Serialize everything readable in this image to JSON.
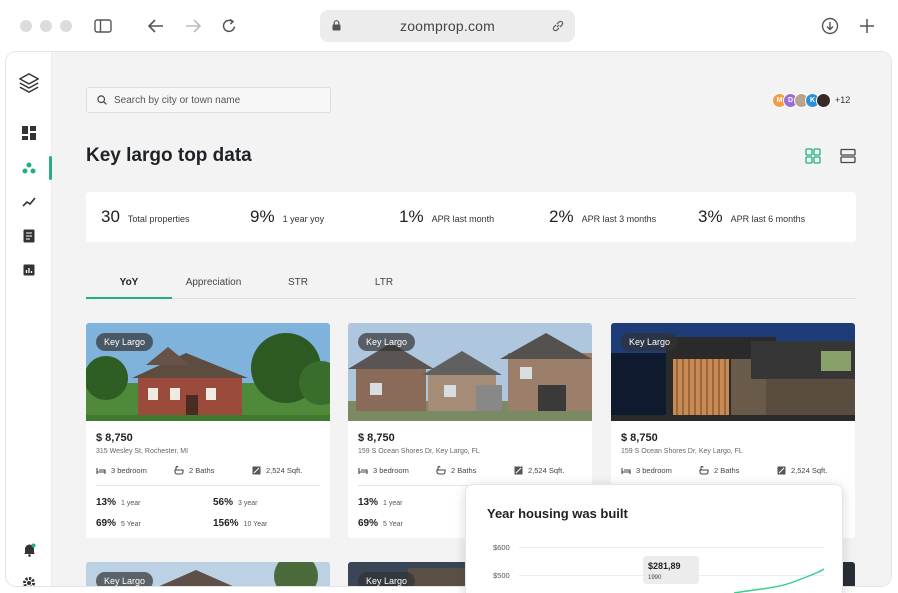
{
  "browser": {
    "url": "zoomprop.com"
  },
  "search": {
    "placeholder": "Search by city or town name"
  },
  "avatars": {
    "initials": [
      "M",
      "D",
      "",
      "K",
      ""
    ],
    "more_label": "+12"
  },
  "page": {
    "title": "Key largo top data"
  },
  "stats": [
    {
      "value": "30",
      "label": "Total properties"
    },
    {
      "value": "9%",
      "label": "1 year yoy"
    },
    {
      "value": "1%",
      "label": "APR last month"
    },
    {
      "value": "2%",
      "label": "APR last 3 months"
    },
    {
      "value": "3%",
      "label": "APR last 6 months"
    }
  ],
  "tabs": [
    "YoY",
    "Appreciation",
    "STR",
    "LTR"
  ],
  "active_tab": "YoY",
  "cards": [
    {
      "badge": "Key Largo",
      "price": "$ 8,750",
      "address": "315 Wesley St, Rochester, MI",
      "bedrooms": "3 bedroom",
      "baths": "2 Baths",
      "sqft": "2,524 Sqft.",
      "metrics": [
        {
          "value": "13%",
          "label": "1 year"
        },
        {
          "value": "56%",
          "label": "3 year"
        },
        {
          "value": "69%",
          "label": "5 Year"
        },
        {
          "value": "156%",
          "label": "10 Year"
        }
      ]
    },
    {
      "badge": "Key Largo",
      "price": "$ 8,750",
      "address": "159 S Ocean Shores Dr, Key Largo, FL",
      "bedrooms": "3 bedroom",
      "baths": "2 Baths",
      "sqft": "2,524 Sqft.",
      "metrics": [
        {
          "value": "13%",
          "label": "1 year"
        },
        {
          "value": "69%",
          "label": "5 Year"
        }
      ]
    },
    {
      "badge": "Key Largo",
      "price": "$ 8,750",
      "address": "159 S Ocean Shores Dr, Key Largo, FL",
      "bedrooms": "3 bedroom",
      "baths": "2 Baths",
      "sqft": "2,524 Sqft."
    }
  ],
  "bottom_cards": [
    {
      "badge": "Key Largo"
    },
    {
      "badge": "Key Largo"
    }
  ],
  "popup": {
    "title": "Year housing was built",
    "y_ticks": [
      "$600",
      "$500"
    ],
    "tooltip": {
      "value": "$281,89",
      "year": "1990"
    }
  },
  "colors": {
    "accent": "#22b07d",
    "background": "#f3f3f3"
  },
  "icons": {
    "sidebar": [
      "layers-logo-icon",
      "dashboard-icon",
      "community-icon",
      "trend-icon",
      "document-icon",
      "chart-icon",
      "notification-bell-icon",
      "settings-icon"
    ]
  }
}
